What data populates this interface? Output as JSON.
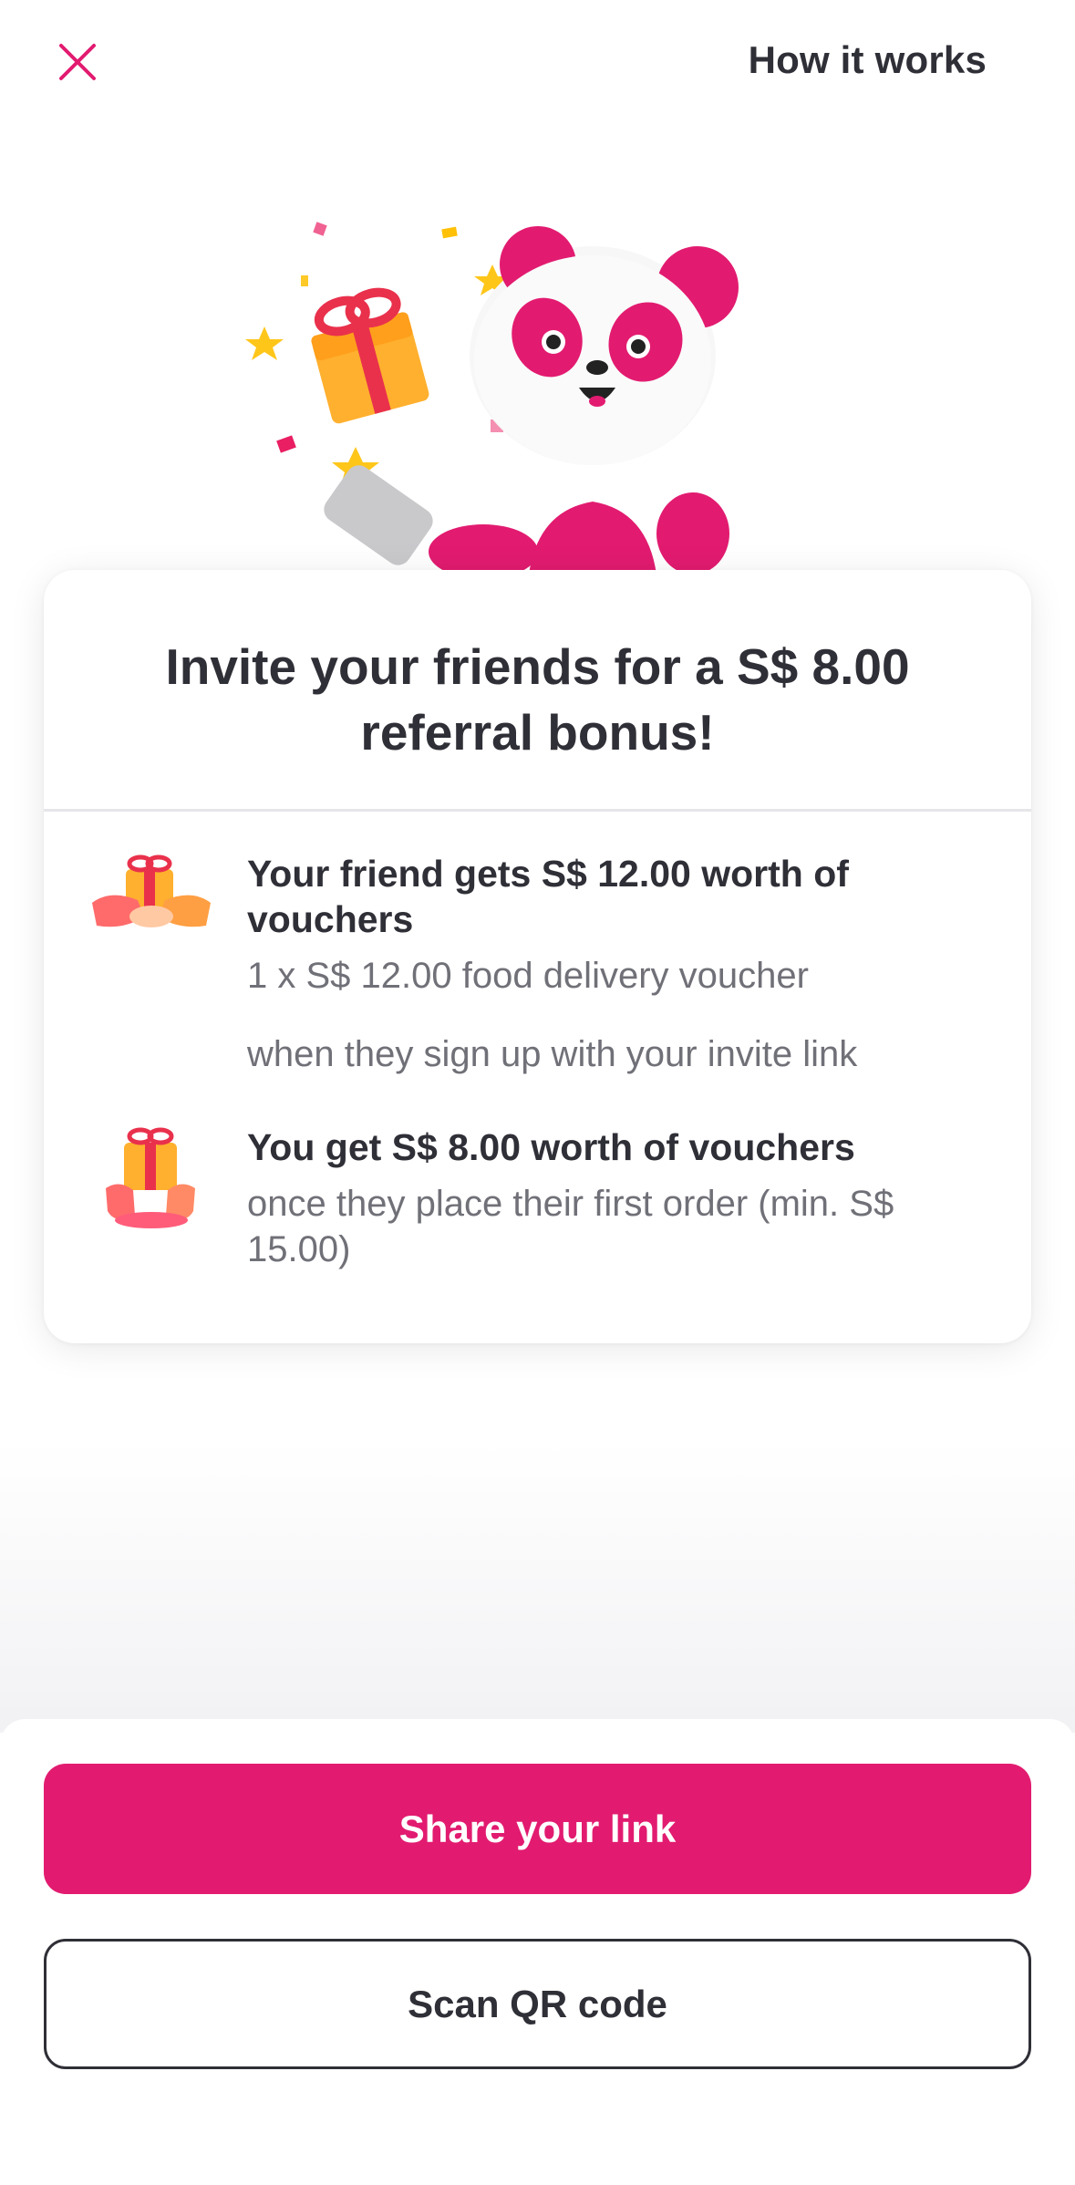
{
  "header": {
    "close_icon": "close-icon",
    "how_it_works_label": "How it works"
  },
  "hero": {
    "illustration": "panda-mascot-with-gift-and-phone"
  },
  "card": {
    "title": "Invite your friends for a S$ 8.00 referral bonus!",
    "benefits": [
      {
        "icon": "gift-handover-icon",
        "title": "Your friend gets S$ 12.00 worth of vouchers",
        "details": [
          "1 x S$ 12.00 food delivery voucher",
          "when they sign up with your invite link"
        ]
      },
      {
        "icon": "gift-in-hands-icon",
        "title": "You get S$ 8.00 worth of vouchers",
        "details": [
          "once they place their first order (min. S$ 15.00)"
        ]
      }
    ]
  },
  "actions": {
    "share_label": "Share your link",
    "scan_label": "Scan QR code"
  },
  "colors": {
    "brand": "#e21b70",
    "text": "#2f2f37",
    "muted": "#707078"
  }
}
